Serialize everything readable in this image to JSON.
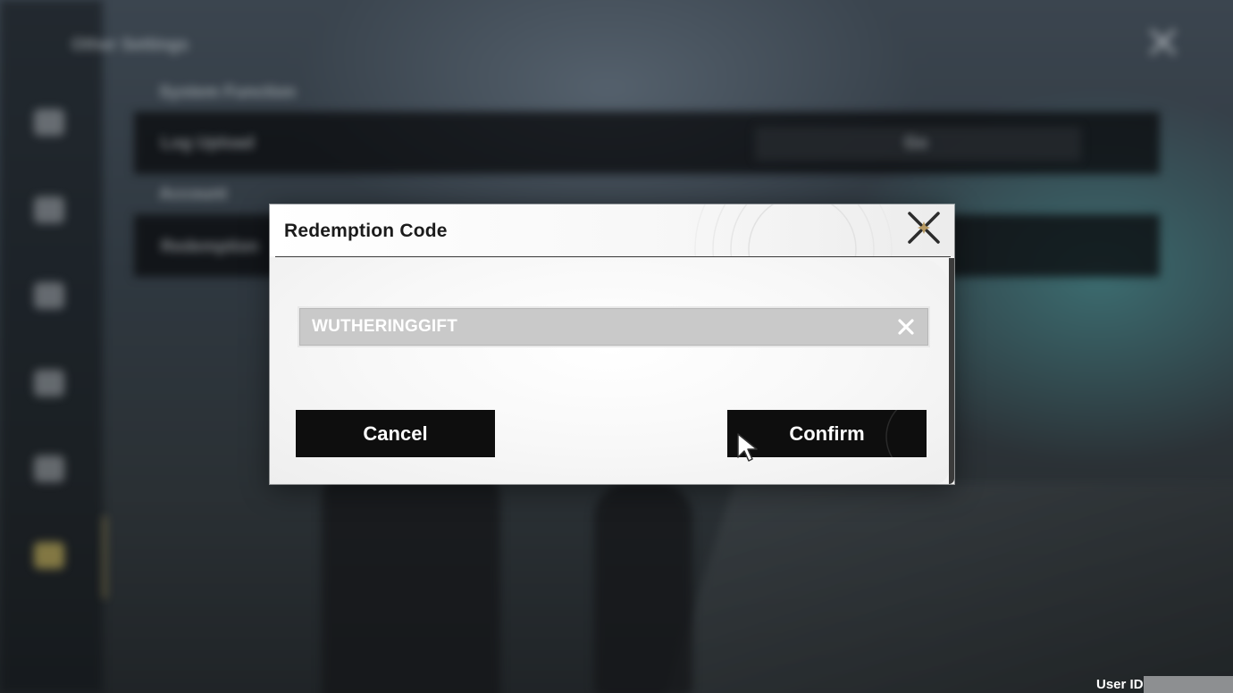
{
  "background": {
    "sidebar_title": "Other Settings",
    "section_system": "System Function",
    "row_log_upload": "Log Upload",
    "row_log_upload_value": "Go",
    "section_account": "Account",
    "row_redemption": "Redemption"
  },
  "dialog": {
    "title": "Redemption Code",
    "code_value": "WUTHERINGGIFT",
    "cancel_label": "Cancel",
    "confirm_label": "Confirm"
  },
  "footer": {
    "user_id_label": "User ID:"
  },
  "icons": {
    "dialog_close": "close-star-icon",
    "clear_input": "x-icon",
    "cursor": "mouse-pointer-icon"
  },
  "colors": {
    "dialog_bg": "#f4f4f4",
    "button_bg": "#0e0e0e",
    "input_bg": "#c9c9c9",
    "text_dark": "#1b1b1b"
  }
}
